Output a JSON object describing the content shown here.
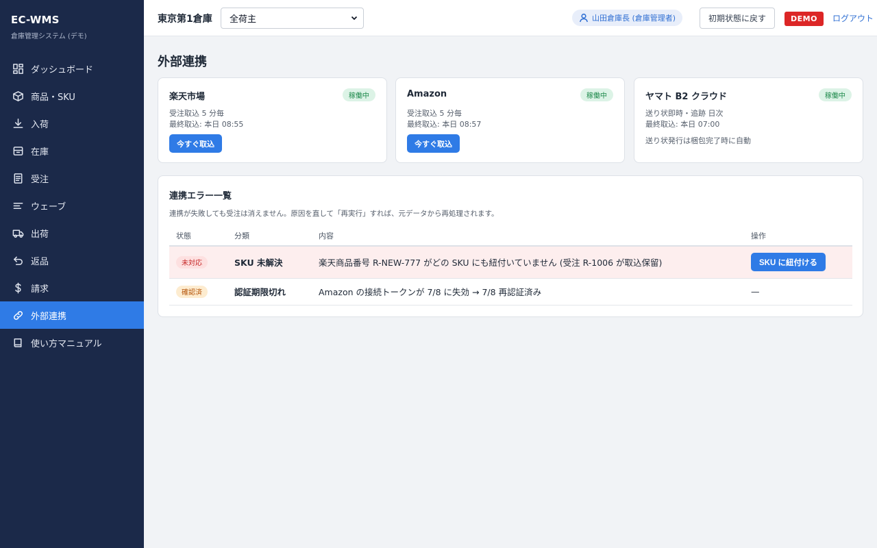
{
  "brand": {
    "title": "EC-WMS",
    "subtitle": "倉庫管理システム (デモ)"
  },
  "sidebar": {
    "items": [
      {
        "label": "ダッシュボード",
        "icon": "dashboard-icon"
      },
      {
        "label": "商品・SKU",
        "icon": "box-icon"
      },
      {
        "label": "入荷",
        "icon": "download-icon"
      },
      {
        "label": "在庫",
        "icon": "archive-icon"
      },
      {
        "label": "受注",
        "icon": "document-icon"
      },
      {
        "label": "ウェーブ",
        "icon": "lines-icon"
      },
      {
        "label": "出荷",
        "icon": "truck-icon"
      },
      {
        "label": "返品",
        "icon": "return-icon"
      },
      {
        "label": "請求",
        "icon": "dollar-icon"
      },
      {
        "label": "外部連携",
        "icon": "link-icon",
        "active": true
      },
      {
        "label": "使い方マニュアル",
        "icon": "book-icon"
      }
    ]
  },
  "topbar": {
    "warehouse": "東京第1倉庫",
    "shipper_selected": "全荷主",
    "user": "山田倉庫長 (倉庫管理者)",
    "reset_label": "初期状態に戻す",
    "demo_label": "DEMO",
    "logout_label": "ログアウト"
  },
  "page": {
    "title": "外部連携"
  },
  "integrations": [
    {
      "name": "楽天市場",
      "status": "稼働中",
      "line1": "受注取込 5 分毎",
      "line2": "最終取込: 本日 08:55",
      "button": "今すぐ取込"
    },
    {
      "name": "Amazon",
      "status": "稼働中",
      "line1": "受注取込 5 分毎",
      "line2": "最終取込: 本日 08:57",
      "button": "今すぐ取込"
    },
    {
      "name": "ヤマト B2 クラウド",
      "status": "稼働中",
      "line1": "送り状即時・追跡 日次",
      "line2": "最終取込: 本日 07:00",
      "note": "送り状発行は梱包完了時に自動"
    }
  ],
  "errors": {
    "title": "連携エラー一覧",
    "description": "連携が失敗しても受注は消えません。原因を直して「再実行」すれば、元データから再処理されます。",
    "headers": {
      "status": "状態",
      "category": "分類",
      "content": "内容",
      "action": "操作"
    },
    "rows": [
      {
        "status": "未対応",
        "category": "SKU 未解決",
        "content": "楽天商品番号 R-NEW-777 がどの SKU にも紐付いていません (受注 R-1006 が取込保留)",
        "action": "SKU に紐付ける"
      },
      {
        "status": "確認済",
        "category": "認証期限切れ",
        "content": "Amazon の接続トークンが 7/8 に失効 → 7/8 再認証済み",
        "action": "—"
      }
    ]
  },
  "colors": {
    "sidebar_bg": "#1b2949",
    "accent": "#2f7be6",
    "success": "#1f8a4c",
    "danger": "#dc2626",
    "warning": "#b45309"
  }
}
